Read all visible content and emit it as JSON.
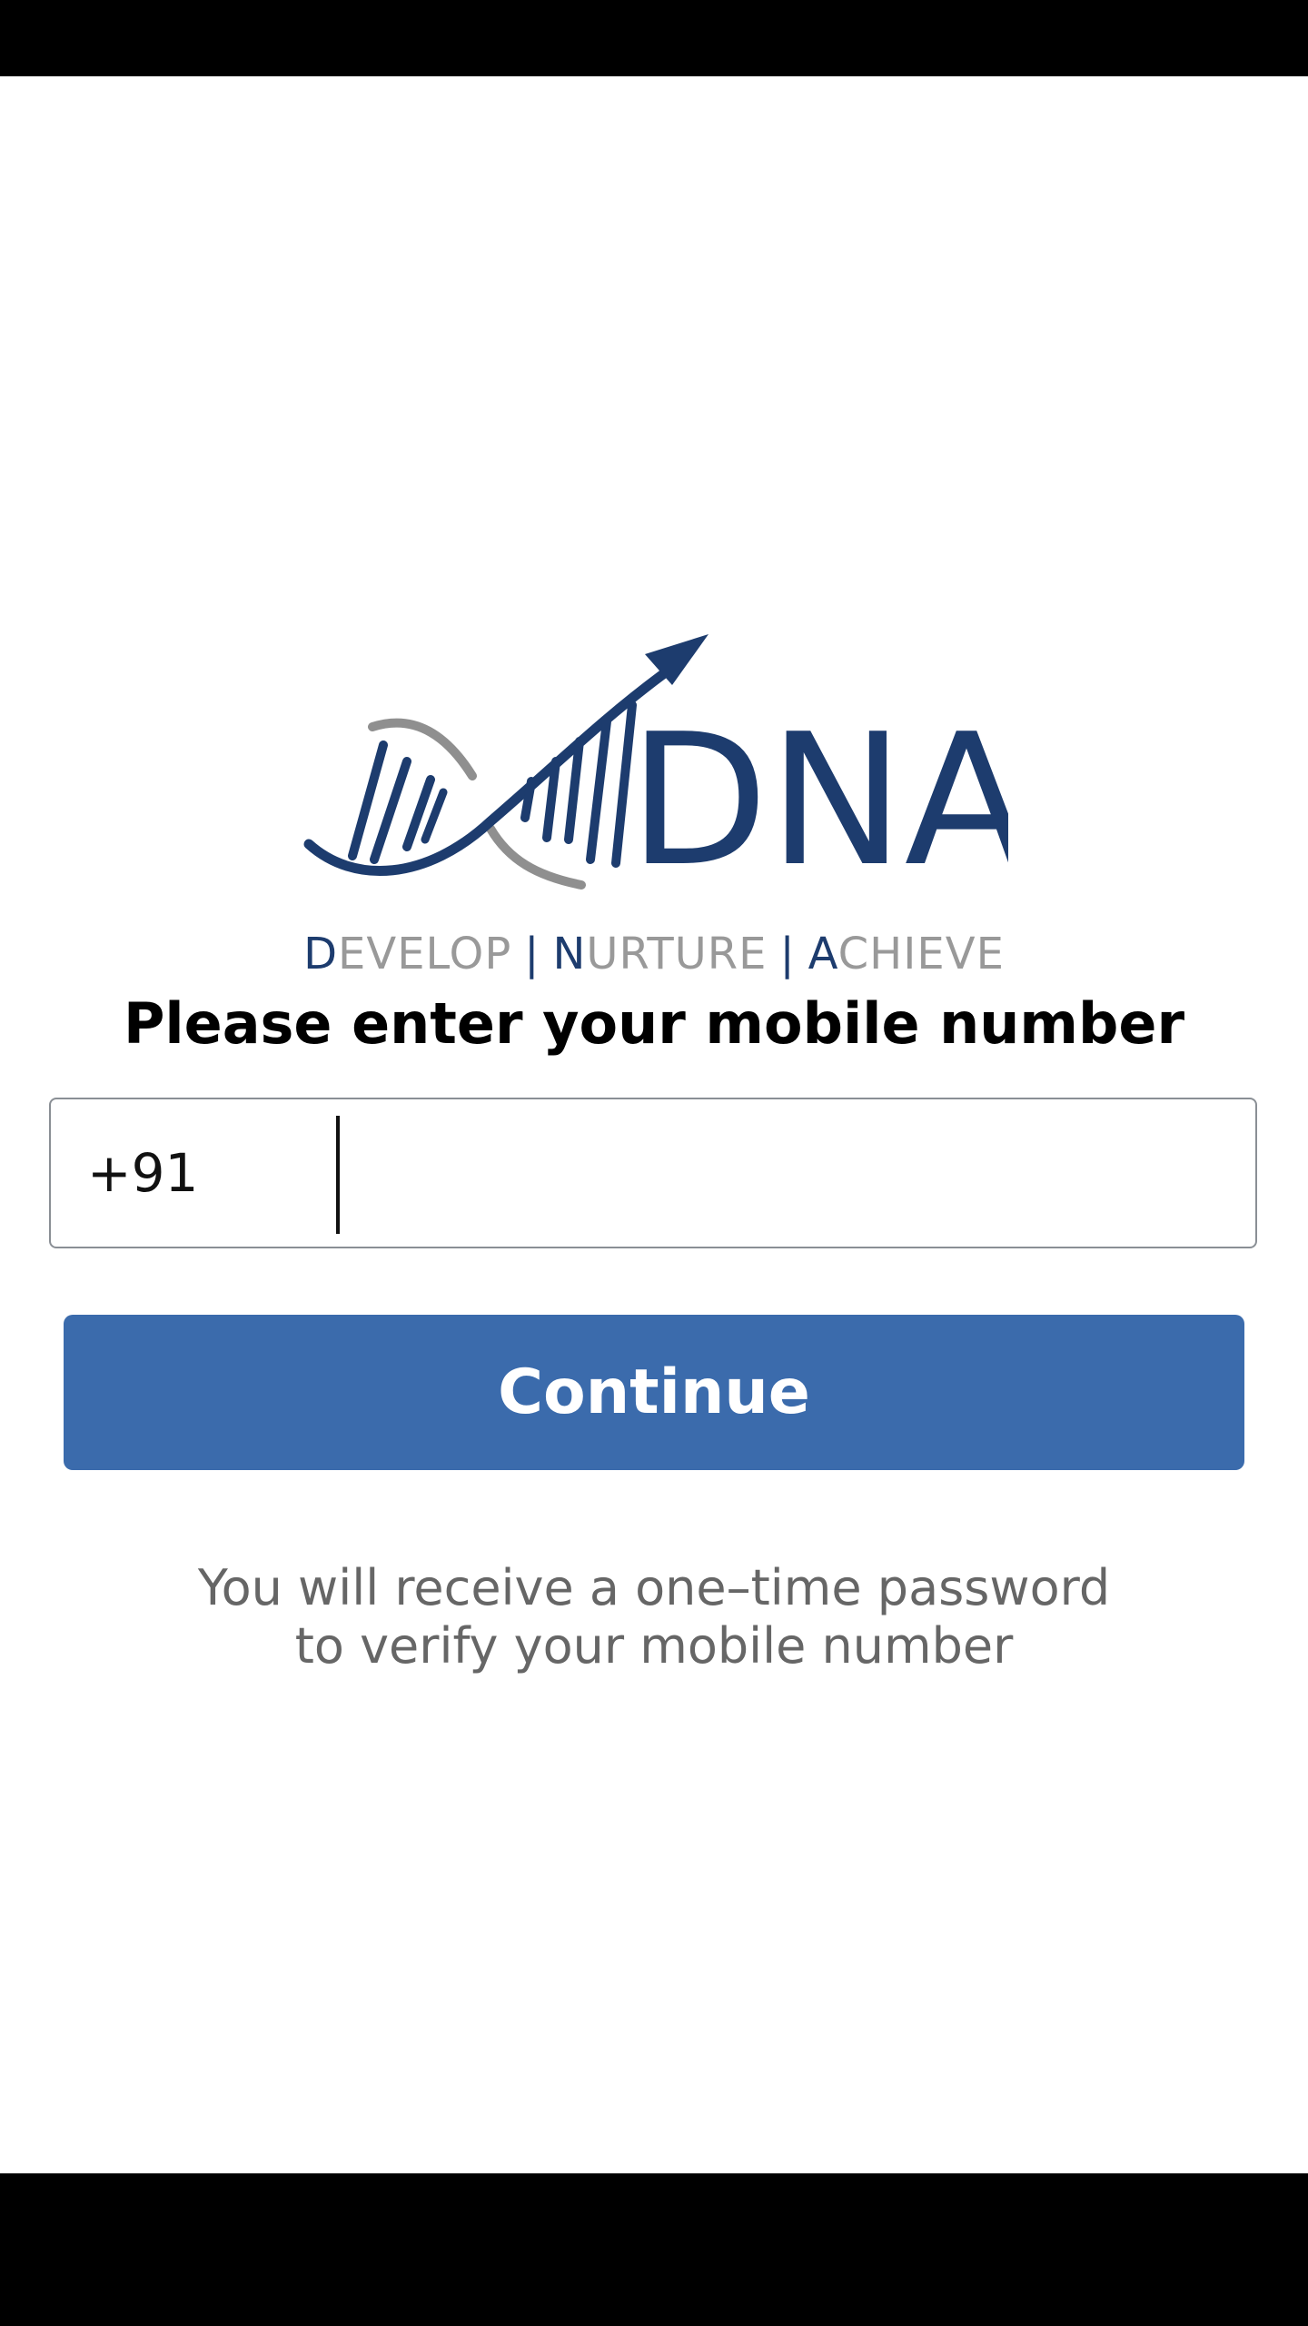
{
  "brand": {
    "name": "DNA",
    "tagline": [
      {
        "initial": "D",
        "rest": "EVELOP"
      },
      {
        "initial": "N",
        "rest": "URTURE"
      },
      {
        "initial": "A",
        "rest": "CHIEVE"
      }
    ],
    "tagline_separator": "|",
    "colors": {
      "navy": "#1d3c6e",
      "gray": "#999999"
    }
  },
  "login": {
    "heading": "Please enter your mobile number",
    "country_code": "+91",
    "phone_value": "",
    "continue_label": "Continue",
    "info_line1": "You will receive a one–time password",
    "info_line2": "to verify your mobile number"
  },
  "colors": {
    "accent": "#3b6bac",
    "text": "#000000",
    "muted": "#666666",
    "border": "#8a8f95"
  }
}
